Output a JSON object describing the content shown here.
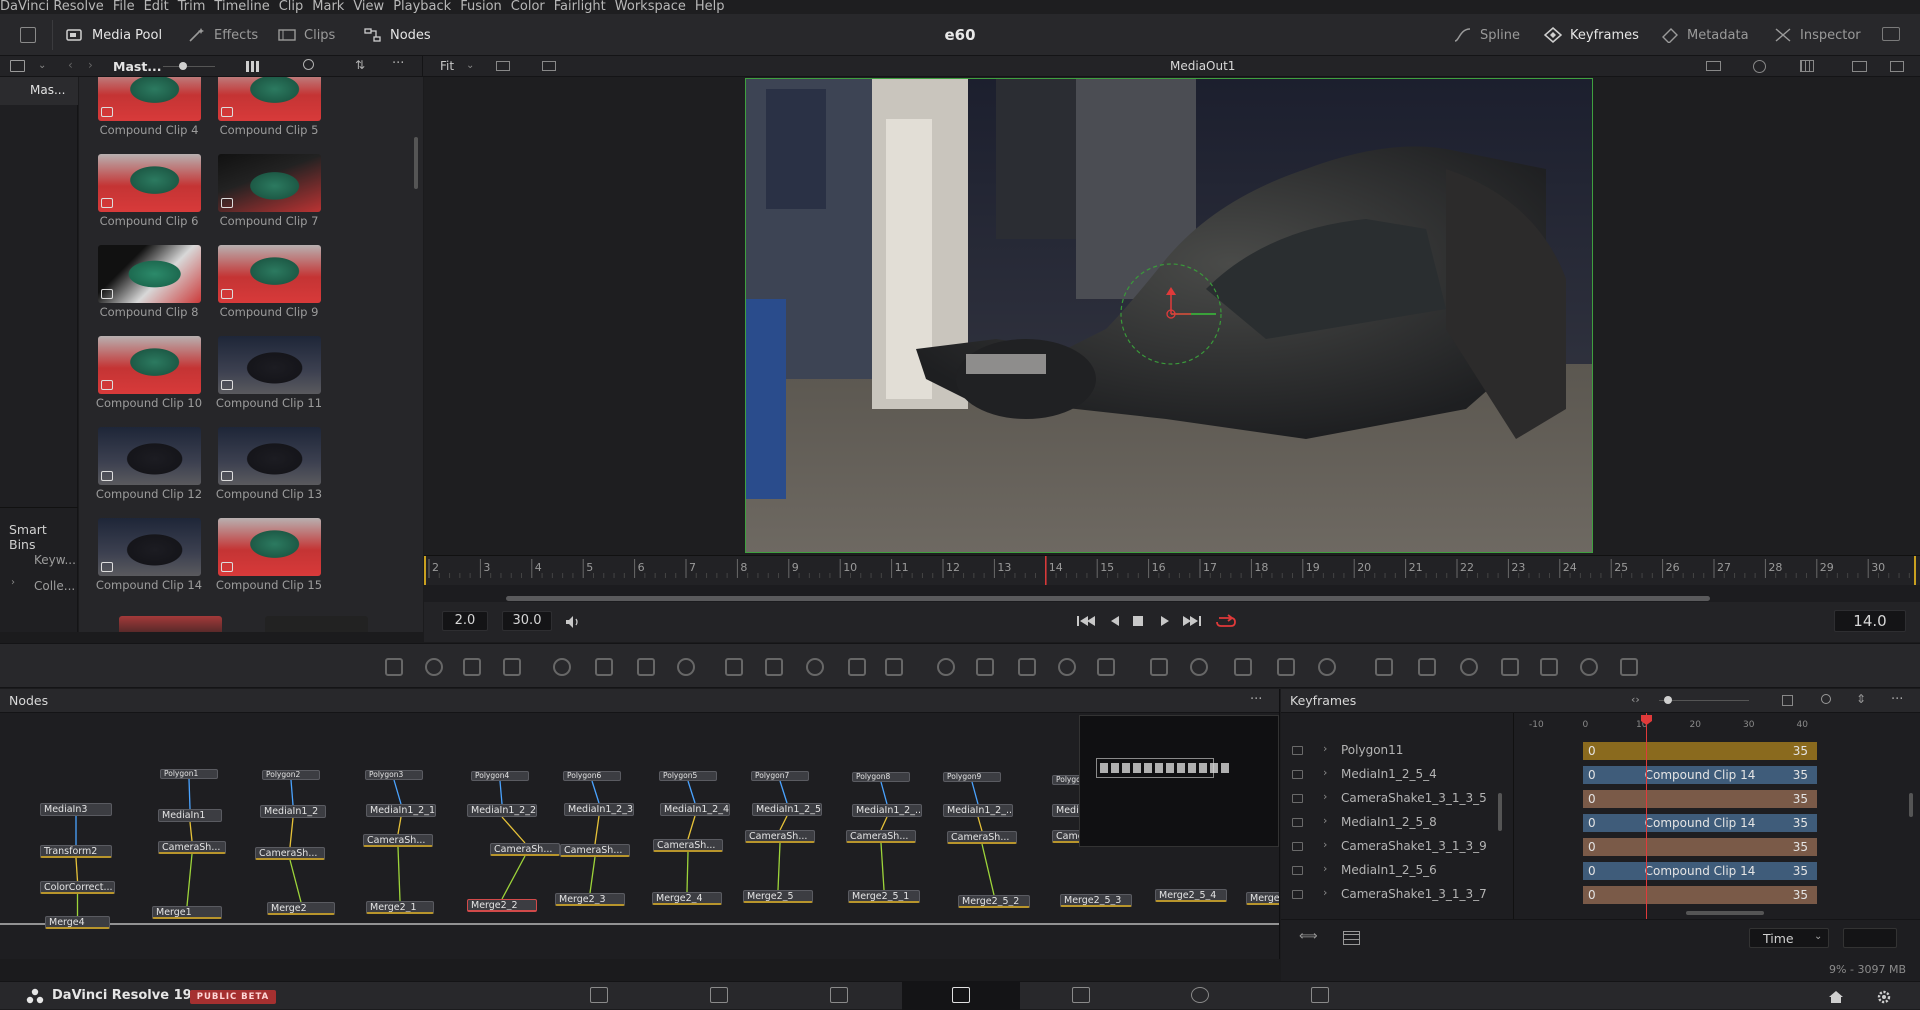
{
  "menubar": [
    "DaVinci Resolve",
    "File",
    "Edit",
    "Trim",
    "Timeline",
    "Clip",
    "Mark",
    "View",
    "Playback",
    "Fusion",
    "Color",
    "Fairlight",
    "Workspace",
    "Help"
  ],
  "toolbar": {
    "left": [
      {
        "label": "Media Pool",
        "icon": "media-pool-icon",
        "active": true
      },
      {
        "label": "Effects",
        "icon": "effects-icon",
        "active": false
      },
      {
        "label": "Clips",
        "icon": "clips-icon",
        "active": false
      },
      {
        "label": "Nodes",
        "icon": "nodes-icon",
        "active": true
      }
    ],
    "project_title": "e60",
    "right": [
      {
        "label": "Spline",
        "icon": "spline-icon",
        "active": false
      },
      {
        "label": "Keyframes",
        "icon": "keyframes-icon",
        "active": true
      },
      {
        "label": "Metadata",
        "icon": "metadata-icon",
        "active": false
      },
      {
        "label": "Inspector",
        "icon": "inspector-icon",
        "active": false
      }
    ]
  },
  "subtoolbar": {
    "bin_name": "Mast...",
    "fit_label": "Fit",
    "viewer_label": "MediaOut1"
  },
  "bins": {
    "master_label": "Mas...",
    "smart_bins_label": "Smart Bins",
    "items": [
      "Keyw...",
      "Colle..."
    ]
  },
  "clips": [
    {
      "name": "Compound Clip 4",
      "style": "red"
    },
    {
      "name": "Compound Clip 5",
      "style": "red"
    },
    {
      "name": "Compound Clip 6",
      "style": "red"
    },
    {
      "name": "Compound Clip 7",
      "style": "dark-red"
    },
    {
      "name": "Compound Clip 8",
      "style": "white"
    },
    {
      "name": "Compound Clip 9",
      "style": "red"
    },
    {
      "name": "Compound Clip 10",
      "style": "red"
    },
    {
      "name": "Compound Clip 11",
      "style": "night"
    },
    {
      "name": "Compound Clip 12",
      "style": "night"
    },
    {
      "name": "Compound Clip 13",
      "style": "night"
    },
    {
      "name": "Compound Clip 14",
      "style": "night"
    },
    {
      "name": "Compound Clip 15",
      "style": "red"
    }
  ],
  "ruler": {
    "ticks": [
      "2",
      "3",
      "4",
      "5",
      "6",
      "7",
      "8",
      "9",
      "10",
      "11",
      "12",
      "13",
      "14",
      "15",
      "16",
      "17",
      "18",
      "19",
      "20",
      "21",
      "22",
      "23",
      "24",
      "25",
      "26",
      "27",
      "28",
      "29",
      "30"
    ],
    "playhead": 14
  },
  "transport": {
    "render_start": "2.0",
    "render_end": "30.0",
    "current_time": "14.0"
  },
  "nodes_panel": {
    "title": "Nodes",
    "nodes": [
      {
        "id": "MediaIn3",
        "label": "MediaIn3"
      },
      {
        "id": "Transform2",
        "label": "Transform2"
      },
      {
        "id": "ColorCorrect",
        "label": "ColorCorrect..."
      },
      {
        "id": "Merge4",
        "label": "Merge4"
      },
      {
        "id": "Polygon1",
        "label": "Polygon1"
      },
      {
        "id": "MediaIn1",
        "label": "MediaIn1"
      },
      {
        "id": "CameraSh1",
        "label": "CameraSh..."
      },
      {
        "id": "Merge1",
        "label": "Merge1"
      },
      {
        "id": "Polygon2",
        "label": "Polygon2"
      },
      {
        "id": "MediaIn1_2",
        "label": "MediaIn1_2"
      },
      {
        "id": "CameraSh2",
        "label": "CameraSh..."
      },
      {
        "id": "Merge2",
        "label": "Merge2"
      },
      {
        "id": "Polygon3",
        "label": "Polygon3"
      },
      {
        "id": "MediaIn1_2_1",
        "label": "MediaIn1_2_1"
      },
      {
        "id": "CameraSh3",
        "label": "CameraSh..."
      },
      {
        "id": "Merge2_1",
        "label": "Merge2_1"
      },
      {
        "id": "Polygon4",
        "label": "Polygon4"
      },
      {
        "id": "MediaIn1_2_2",
        "label": "MediaIn1_2_2"
      },
      {
        "id": "CameraSh4",
        "label": "CameraSh..."
      },
      {
        "id": "Merge2_2",
        "label": "Merge2_2"
      },
      {
        "id": "Polygon6",
        "label": "Polygon6"
      },
      {
        "id": "MediaIn1_2_3",
        "label": "MediaIn1_2_3"
      },
      {
        "id": "CameraSh5",
        "label": "CameraSh..."
      },
      {
        "id": "Merge2_3",
        "label": "Merge2_3"
      },
      {
        "id": "Polygon5",
        "label": "Polygon5"
      },
      {
        "id": "MediaIn1_2_4",
        "label": "MediaIn1_2_4"
      },
      {
        "id": "CameraSh6",
        "label": "CameraSh..."
      },
      {
        "id": "Merge2_4",
        "label": "Merge2_4"
      },
      {
        "id": "Polygon7",
        "label": "Polygon7"
      },
      {
        "id": "MediaIn1_2_5",
        "label": "MediaIn1_2_5"
      },
      {
        "id": "CameraSh7",
        "label": "CameraSh..."
      },
      {
        "id": "Merge2_5",
        "label": "Merge2_5"
      },
      {
        "id": "Polygon8",
        "label": "Polygon8"
      },
      {
        "id": "MediaIn1_2_a",
        "label": "MediaIn1_2_..."
      },
      {
        "id": "CameraSh8",
        "label": "CameraSh..."
      },
      {
        "id": "Merge2_5_1",
        "label": "Merge2_5_1"
      },
      {
        "id": "Polygon9",
        "label": "Polygon9"
      },
      {
        "id": "MediaIn1_2_b",
        "label": "MediaIn1_2_..."
      },
      {
        "id": "CameraSh9",
        "label": "CameraSh..."
      },
      {
        "id": "Merge2_5_2",
        "label": "Merge2_5_2"
      },
      {
        "id": "Polygon10",
        "label": "Polygor"
      },
      {
        "id": "MediaIn1_2_c",
        "label": "Media"
      },
      {
        "id": "CameraSh10",
        "label": "Came"
      },
      {
        "id": "Merge2_5_3",
        "label": "Merge2_5_3"
      },
      {
        "id": "Merge2_5_4",
        "label": "Merge2_5_4"
      },
      {
        "id": "Merge_last",
        "label": "Merge"
      }
    ]
  },
  "keyframes_panel": {
    "title": "Keyframes",
    "ruler_ticks": [
      "-10",
      "0",
      "10",
      "20",
      "30",
      "40"
    ],
    "rows": [
      {
        "name": "Polygon11",
        "start": "0",
        "end": "35",
        "clip": "",
        "color": "#8a6a1e"
      },
      {
        "name": "MediaIn1_2_5_4",
        "start": "0",
        "end": "35",
        "clip": "Compound Clip 14",
        "color": "#3f5c7a"
      },
      {
        "name": "CameraShake1_3_1_3_5",
        "start": "0",
        "end": "35",
        "clip": "",
        "color": "#7a5a48"
      },
      {
        "name": "MediaIn1_2_5_8",
        "start": "0",
        "end": "35",
        "clip": "Compound Clip 14",
        "color": "#3f5c7a"
      },
      {
        "name": "CameraShake1_3_1_3_9",
        "start": "0",
        "end": "35",
        "clip": "",
        "color": "#7a5a48"
      },
      {
        "name": "MediaIn1_2_5_6",
        "start": "0",
        "end": "35",
        "clip": "Compound Clip 14",
        "color": "#3f5c7a"
      },
      {
        "name": "CameraShake1_3_1_3_7",
        "start": "0",
        "end": "35",
        "clip": "",
        "color": "#7a5a48"
      }
    ],
    "time_mode": "Time"
  },
  "status": {
    "memory": "9% - 3097 MB"
  },
  "app": {
    "name": "DaVinci Resolve 19",
    "badge": "PUBLIC BETA"
  },
  "pages": [
    "media-page-icon",
    "cut-page-icon",
    "edit-page-icon",
    "fusion-page-icon",
    "color-page-icon",
    "fairlight-page-icon",
    "deliver-page-icon"
  ],
  "active_page": "fusion-page-icon"
}
